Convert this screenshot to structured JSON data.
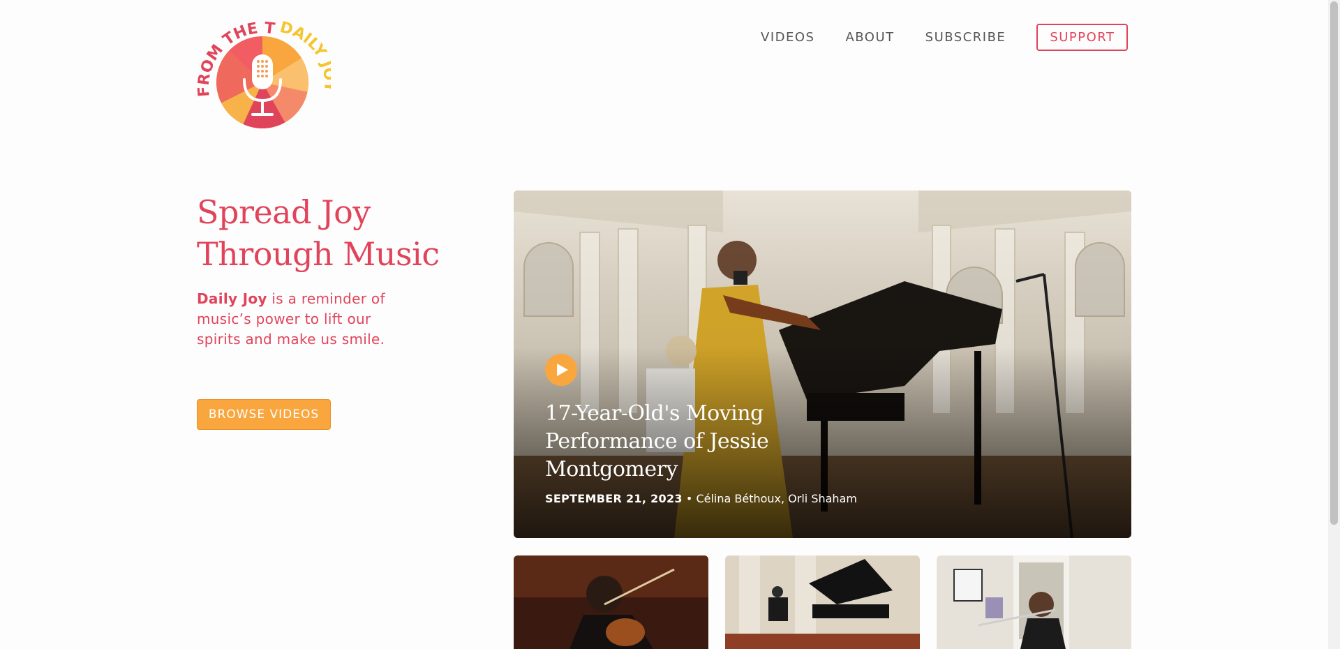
{
  "logo": {
    "text": "FROM THE TOP DAILY JOY",
    "arc_text_left": "FROM THE TOP",
    "arc_text_right": "DAILY JOY"
  },
  "nav": {
    "items": [
      "VIDEOS",
      "ABOUT",
      "SUBSCRIBE"
    ],
    "support_label": "SUPPORT"
  },
  "hero": {
    "title_line1": "Spread Joy",
    "title_line2": "Through Music",
    "desc_bold": "Daily Joy",
    "desc_rest": " is a reminder of music’s power to lift our spirits and make us smile.",
    "browse_label": "BROWSE VIDEOS"
  },
  "featured": {
    "title": "17-Year-Old's Moving Performance of Jessie Montgomery",
    "date": "SEPTEMBER 21, 2023",
    "separator": "•",
    "performers": "Célina Béthoux, Orli Shaham"
  },
  "colors": {
    "brand_red": "#e0445b",
    "accent_orange": "#f9a63f",
    "accent_yellow": "#f4c531"
  },
  "icons": {
    "play": "play-icon",
    "microphone": "microphone-icon"
  }
}
